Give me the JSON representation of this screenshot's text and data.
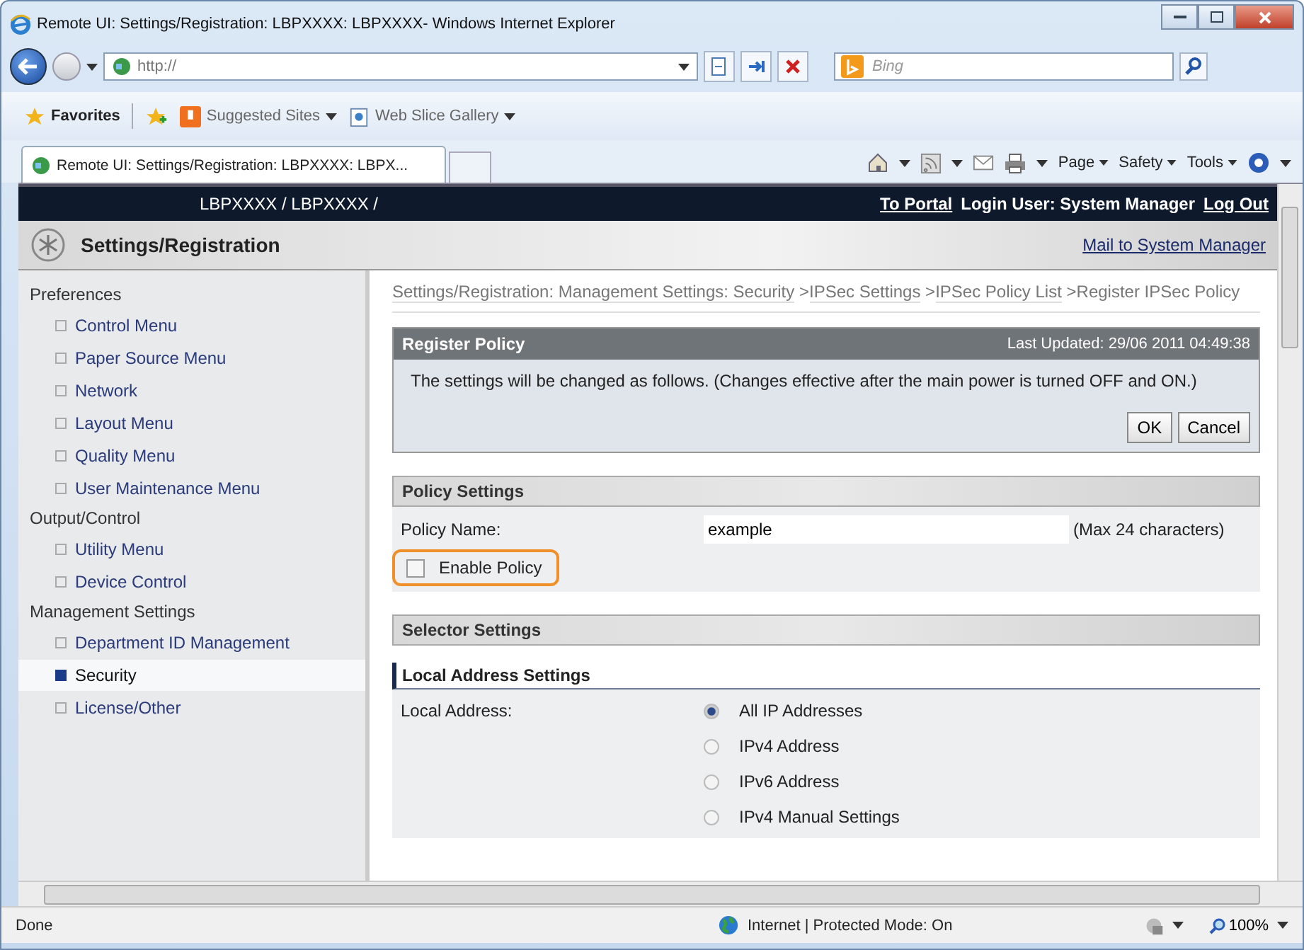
{
  "window": {
    "title": "Remote UI: Settings/Registration: LBPXXXX: LBPXXXX- Windows Internet Explorer"
  },
  "address_bar": {
    "value": "http://"
  },
  "search": {
    "placeholder": "Bing"
  },
  "favorites_bar": {
    "favorites": "Favorites",
    "links": [
      "Suggested Sites",
      "Web Slice Gallery"
    ]
  },
  "tabs": [
    {
      "label": "Remote UI: Settings/Registration: LBPXXXX: LBPX...",
      "selected": true
    }
  ],
  "command_bar": [
    "Page",
    "Safety",
    "Tools"
  ],
  "page_header": {
    "device": "LBPXXXX / LBPXXXX /",
    "portal_link": "To Portal",
    "login_user": "Login User: System Manager",
    "logout_link": "Log Out"
  },
  "page_title": {
    "title": "Settings/Registration",
    "mail_link": "Mail to System Manager"
  },
  "sidebar": [
    {
      "label": "Preferences",
      "children": [
        {
          "label": "Control Menu",
          "selected": false
        },
        {
          "label": "Paper Source Menu",
          "selected": false
        },
        {
          "label": "Network",
          "selected": false
        },
        {
          "label": "Layout Menu",
          "selected": false
        },
        {
          "label": "Quality Menu",
          "selected": false
        },
        {
          "label": "User Maintenance Menu",
          "selected": false
        }
      ]
    },
    {
      "label": "Output/Control",
      "children": [
        {
          "label": "Utility Menu",
          "selected": false
        },
        {
          "label": "Device Control",
          "selected": false
        }
      ]
    },
    {
      "label": "Management Settings",
      "children": [
        {
          "label": "Department ID Management",
          "selected": false
        },
        {
          "label": "Security",
          "selected": true
        },
        {
          "label": "License/Other",
          "selected": false
        }
      ]
    }
  ],
  "breadcrumb": {
    "links": [
      "Settings/Registration: Management Settings: Security",
      "IPSec Settings",
      "IPSec Policy List"
    ],
    "separator": ">",
    "current": "Register IPSec Policy"
  },
  "register_panel": {
    "title": "Register Policy",
    "last_updated": "Last Updated: 29/06 2011 04:49:38",
    "message": "The settings will be changed as follows. (Changes effective after the main power is turned OFF and ON.)",
    "buttons": [
      "OK",
      "Cancel"
    ]
  },
  "policy_settings": {
    "title": "Policy Settings",
    "name_label": "Policy Name:",
    "name_value": "example",
    "name_hint": "(Max 24 characters)",
    "enable_label": "Enable Policy",
    "enable_checked": false,
    "enable_highlighted": true
  },
  "selector_settings": {
    "title": "Selector Settings",
    "subtitle": "Local Address Settings",
    "label": "Local Address:",
    "options": [
      {
        "label": "All IP Addresses",
        "selected": true
      },
      {
        "label": "IPv4 Address",
        "selected": false
      },
      {
        "label": "IPv6 Address",
        "selected": false
      },
      {
        "label": "IPv4 Manual Settings",
        "selected": false
      }
    ]
  },
  "status_bar": {
    "text": "Done",
    "zone": "Internet | Protected Mode: On",
    "zoom": "100%"
  }
}
